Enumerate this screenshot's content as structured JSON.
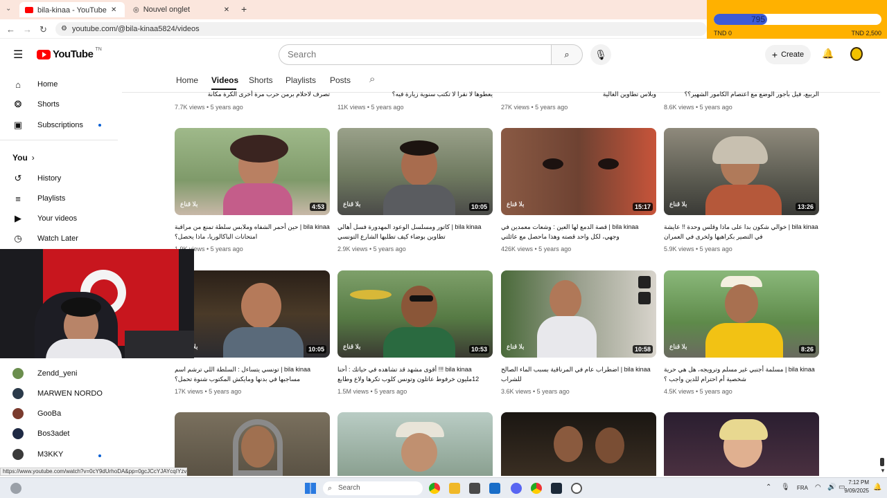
{
  "browser": {
    "tabs": [
      {
        "title": "bila-kinaa - YouTube يلا لقناع",
        "active": true
      },
      {
        "title": "Nouvel onglet",
        "active": false
      }
    ],
    "new_tab": "+",
    "url": "youtube.com/@bila-kinaa5824/videos"
  },
  "extension": {
    "value": "795",
    "min_label": "TND 0",
    "max_label": "TND 2,500",
    "progress_fraction": 0.318
  },
  "header": {
    "logo": "YouTube",
    "country": "TN",
    "search_placeholder": "Search",
    "create_label": "Create"
  },
  "sidebar": {
    "main": [
      {
        "label": "Home",
        "icon": "home-icon"
      },
      {
        "label": "Shorts",
        "icon": "shorts-icon"
      },
      {
        "label": "Subscriptions",
        "icon": "subscriptions-icon"
      }
    ],
    "you_label": "You",
    "you_items": [
      {
        "label": "History",
        "icon": "history-icon"
      },
      {
        "label": "Playlists",
        "icon": "playlists-icon"
      },
      {
        "label": "Your videos",
        "icon": "your-videos-icon"
      },
      {
        "label": "Watch Later",
        "icon": "watch-later-icon"
      }
    ],
    "subscriptions": [
      {
        "label": "Zendd_yeni",
        "color": "#6b8e4e"
      },
      {
        "label": "MARWEN NORDO",
        "color": "#2b3a4a"
      },
      {
        "label": "GooBa",
        "color": "#7a3b2e"
      },
      {
        "label": "Bos3adet",
        "color": "#1f2a44"
      },
      {
        "label": "M3KKY",
        "color": "#3a3a3a"
      }
    ]
  },
  "channel_tabs": [
    "Home",
    "Videos",
    "Shorts",
    "Playlists",
    "Posts"
  ],
  "top_partial": [
    {
      "title": "تصرف لاحلام برمن حرب مرة أخرى الكرة مكانة",
      "meta": "7.7K views • 5 years ago"
    },
    {
      "title": "يعطوها لا نقرا لا تكتب سنوية زيارة فيه؟",
      "meta": "11K views • 5 years ago"
    },
    {
      "title": "وبلاس تطاوين الغالية",
      "meta": "27K views • 5 years ago"
    },
    {
      "title": "الربيع، فيل بأجور الوضع مع اعتصام الكامور الشهير؟؟",
      "meta": "8.6K views • 5 years ago"
    }
  ],
  "row1": [
    {
      "duration": "4:53",
      "title": "bila kinaa | حين أحمر الشفاه وملابس سلطة تمنع من مراقبة امتحانات الباكالوريا، ماذا يحصل؟",
      "meta": "1.9K views • 5 years ago",
      "bg": "#8aa86a"
    },
    {
      "duration": "10:05",
      "title": "bila kinaa | كاتور ومسلسل الوعود المهدورة فسل أهالي تطاوين بوضاء كيف تطلبها الشارع التونسي",
      "meta": "2.9K views • 5 years ago",
      "bg": "#7d8a6d"
    },
    {
      "duration": "15:17",
      "title": "bila kinaa | قصة الدمع لها العين : وشعات معمدين في وجهي، لكل واحد قصته وهذا ماحصل مع عائلتي",
      "meta": "426K views • 5 years ago",
      "bg": "#7a4a36"
    },
    {
      "duration": "13:26",
      "title": "bila kinaa | خوالي شكون بدا على ماذا وقلس وحدة !! عايشة في التصير بكراهيها ولخرى في العمران",
      "meta": "5.9K views • 5 years ago",
      "bg": "#6c6a5e"
    }
  ],
  "row2": [
    {
      "duration": "10:05",
      "title": "bila kinaa | تونسي يتساءل : السلطة اللي ترشم اسم مساجبها في بدنها ومايكش المكتوب شنوة تحمل؟",
      "meta": "17K views • 5 years ago",
      "bg": "#3b2f22"
    },
    {
      "duration": "10:53",
      "title": "bila kinaa !!! أقوى مشهد قد تشاهده في حياتك : أحنا 12مليون خرفوط عاتلون وتونس كلوب تكرها ولاع وطابع",
      "meta": "1.5M views • 5 years ago",
      "bg": "#5f7a4c"
    },
    {
      "duration": "10:58",
      "title": "bila kinaa | اضطراب عام في المرناقية بسبب الماء الصالح للشراب",
      "meta": "3.6K views • 5 years ago",
      "bg": "#7f8a7a"
    },
    {
      "duration": "8:26",
      "title": "bila kinaa | مسلمة أجنبي غير مسلم وترويجه، هل هي حرية شخصية أم احترام للدين واجب ؟",
      "meta": "4.5K views • 5 years ago",
      "bg": "#6f9a5a"
    }
  ],
  "row3": [
    {
      "bg": "#6a6152"
    },
    {
      "bg": "#9bb0a8"
    },
    {
      "bg": "#2a2620"
    },
    {
      "bg": "#3a2a34"
    }
  ],
  "watermark": "بلا قناع",
  "status_url": "https://www.youtube.com/watch?v=0cY9dUrhoDA&pp=0gcJCcYJAYcqIYzv",
  "taskbar": {
    "search": "Search",
    "lang": "FRA",
    "time": "7:12 PM",
    "date": "9/09/2025"
  }
}
